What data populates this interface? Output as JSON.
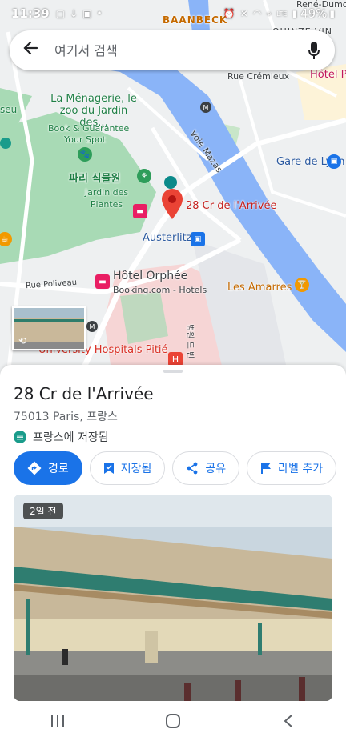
{
  "status_bar": {
    "time": "11:39",
    "battery": "49%",
    "left_icons": [
      "talk-icon",
      "download-icon",
      "gallery-icon",
      "dot-icon"
    ],
    "right_icons": [
      "alarm-icon",
      "mute-icon",
      "wifi-icon",
      "location-icon",
      "lte-icon",
      "signal-icon",
      "battery-icon"
    ]
  },
  "search": {
    "placeholder": "여기서 검색"
  },
  "map": {
    "labels": {
      "baanbeck": "BAANBECK",
      "quinze": "QUINZE-VIN",
      "rene_dumont": "René-Dumont",
      "rue_cremieux": "Rue Crémieux",
      "hotel_p": "Hôtel P",
      "seu": "seu",
      "menagerie": "La Ménagerie, le zoo du Jardin des...",
      "book_guarantee": "Book & Guarantee",
      "your_spot": "Your Spot",
      "voie_mazas": "Voie Mazas",
      "gare_de_lyon": "Gare de Lyon",
      "jardin_kr": "파리 식물원",
      "jardin_fr": "Jardin des Plantes",
      "pin_label": "28 Cr de l'Arrivée",
      "austerlitz": "Austerlitz",
      "rue_poliveau": "Rue Poliveau",
      "hotel_orphee": "Hôtel Orphée",
      "booking_hotels": "Booking.com - Hotels",
      "les_amarres": "Les Amarres",
      "university_hospitals": "University Hospitals Pitié",
      "vertical_kr": "병원 드 빈"
    },
    "colors": {
      "park": "#a8dab5",
      "water": "#8ab4f8",
      "hospital": "#f6d5d5",
      "pin": "#ea4335"
    }
  },
  "place": {
    "title": "28 Cr de l'Arrivée",
    "address": "75013 Paris, 프랑스",
    "saved_text": "프랑스에 저장됨"
  },
  "actions": {
    "directions": "경로",
    "saved": "저장됨",
    "share": "공유",
    "label": "라벨 추가"
  },
  "photo": {
    "badge": "2일 전"
  },
  "colors": {
    "accent": "#1a73e8"
  }
}
